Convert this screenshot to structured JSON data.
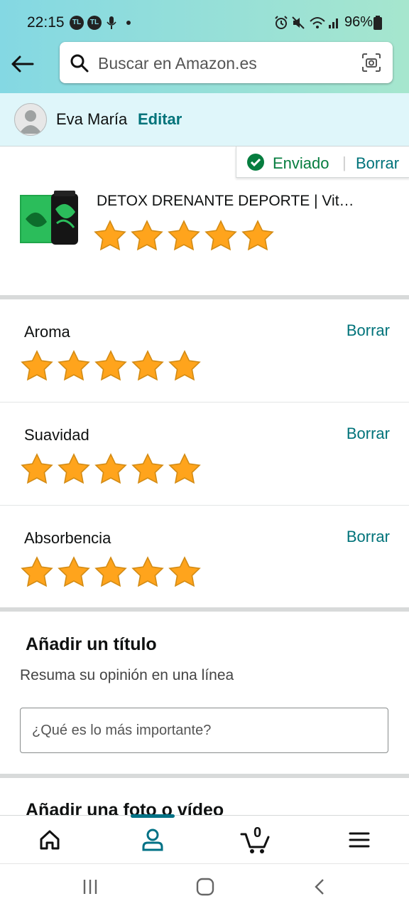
{
  "status_bar": {
    "time": "22:15",
    "battery": "96%"
  },
  "search": {
    "placeholder": "Buscar en Amazon.es"
  },
  "profile": {
    "name": "Eva María",
    "edit_label": "Editar"
  },
  "review_status": {
    "status": "Enviado",
    "delete_label": "Borrar"
  },
  "product": {
    "title": "DETOX DRENANTE DEPORTE | Vit…",
    "rating": 5,
    "max_rating": 5
  },
  "attributes": [
    {
      "label": "Aroma",
      "delete_label": "Borrar",
      "rating": 5
    },
    {
      "label": "Suavidad",
      "delete_label": "Borrar",
      "rating": 5
    },
    {
      "label": "Absorbencia",
      "delete_label": "Borrar",
      "rating": 5
    }
  ],
  "title_section": {
    "heading": "Añadir un título",
    "subheading": "Resuma su opinión en una línea",
    "input_placeholder": "¿Qué es lo más importante?"
  },
  "media_section": {
    "heading": "Añadir una foto o vídeo"
  },
  "bottom_nav": {
    "cart_count": "0",
    "active": "profile"
  },
  "colors": {
    "accent": "#00737a",
    "star": "#ffa41c",
    "sent": "#067d3f"
  },
  "icons": [
    "back-arrow-icon",
    "search-icon",
    "camera-scan-icon",
    "avatar-icon",
    "check-circle-icon",
    "star-icon",
    "home-icon",
    "person-icon",
    "cart-icon",
    "menu-icon"
  ]
}
